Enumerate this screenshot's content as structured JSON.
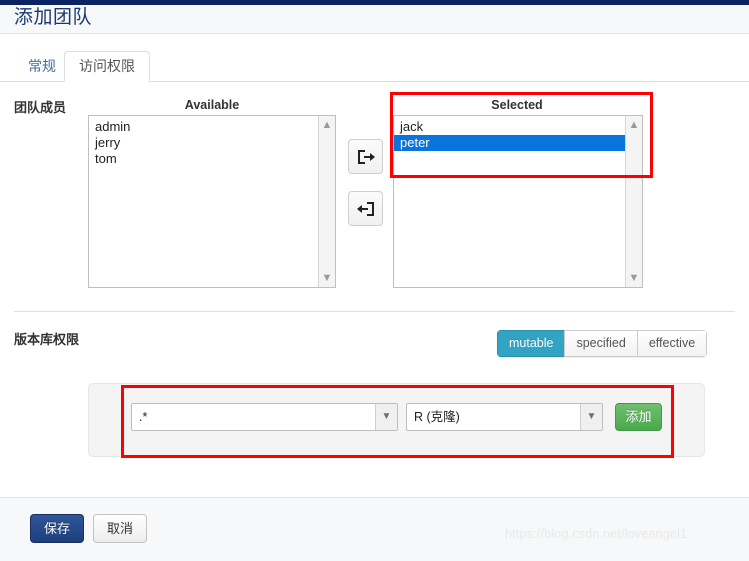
{
  "window": {
    "title": "添加团队"
  },
  "tabs": [
    {
      "label": "常规",
      "active": false
    },
    {
      "label": "访问权限",
      "active": true
    }
  ],
  "members_section": {
    "label": "团队成员",
    "available": {
      "title": "Available",
      "items": [
        "admin",
        "jerry",
        "tom"
      ]
    },
    "selected": {
      "title": "Selected",
      "items": [
        "jack",
        "peter"
      ],
      "highlighted": "peter"
    },
    "transfer": {
      "move_right_icon": "sign-in-arrow-icon",
      "move_left_icon": "sign-out-arrow-icon"
    }
  },
  "repo_section": {
    "label": "版本库权限",
    "modes": [
      {
        "label": "mutable",
        "active": true
      },
      {
        "label": "specified",
        "active": false
      },
      {
        "label": "effective",
        "active": false
      }
    ],
    "row": {
      "path_value": ".*",
      "permission_value": "R (克隆)",
      "add_label": "添加",
      "caret_icon": "chevron-down-icon"
    }
  },
  "footer": {
    "save_label": "保存",
    "cancel_label": "取消"
  },
  "watermark": "https://blog.csdn.net/loveangel1",
  "colors": {
    "navy_strip": "#0b2265",
    "title": "#1b3a6b",
    "selection_blue": "#0a74dc",
    "segment_active": "#31a4c4",
    "add_green": "#4aa94a",
    "save_blue": "#2f5699",
    "annotation_red": "#ff0000"
  }
}
